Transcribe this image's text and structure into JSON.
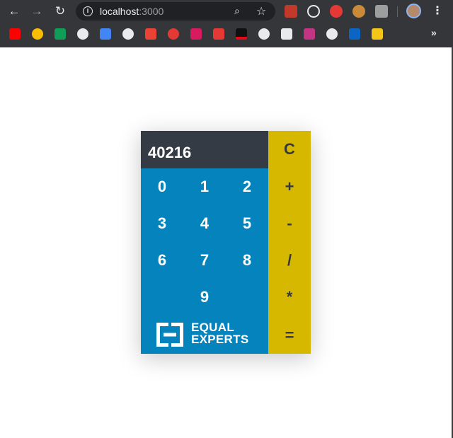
{
  "browser": {
    "url_host": "localhost",
    "url_port": ":3000",
    "info_glyph": "i"
  },
  "calculator": {
    "display": "40216",
    "digits": [
      "0",
      "1",
      "2",
      "3",
      "4",
      "5",
      "6",
      "7",
      "8",
      "9"
    ],
    "operators": {
      "clear": "C",
      "add": "+",
      "subtract": "-",
      "divide": "/",
      "multiply": "*",
      "equals": "="
    },
    "logo_line1": "EQUAL",
    "logo_line2": "EXPERTS"
  },
  "colors": {
    "display_bg": "#353b45",
    "numpad_bg": "#0583bd",
    "operators_bg": "#d7b800",
    "browser_chrome": "#35363a"
  },
  "icons": {
    "back": "arrow-left-icon",
    "forward": "arrow-right-icon",
    "reload": "reload-icon",
    "info": "info-icon",
    "zoom": "zoom-icon",
    "bookmark": "star-icon",
    "menu": "kebab-menu-icon",
    "more_bookmarks": "double-chevron-icon"
  }
}
